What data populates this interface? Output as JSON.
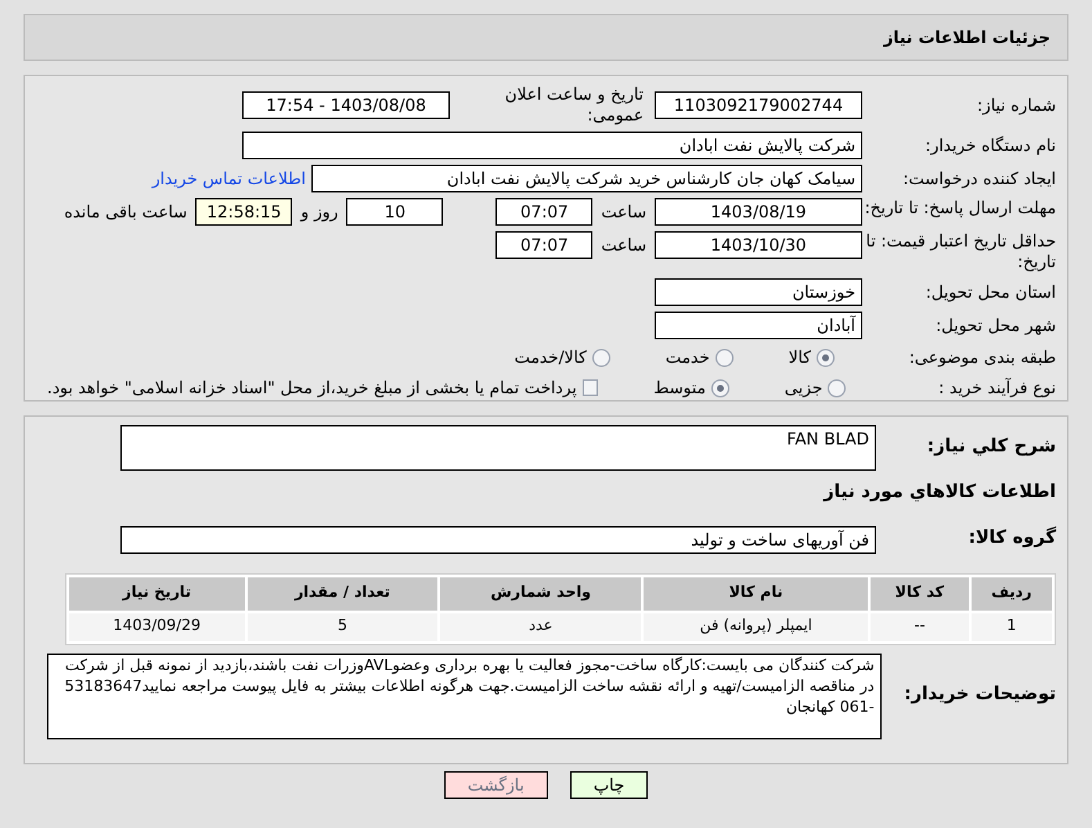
{
  "header": {
    "title": "جزئیات اطلاعات نیاز"
  },
  "need_number": {
    "label": "شماره نیاز:",
    "value": "1103092179002744"
  },
  "announce": {
    "label": "تاریخ و ساعت اعلان عمومی:",
    "value": "1403/08/08 - 17:54"
  },
  "buyer": {
    "label": "نام دستگاه خریدار:",
    "value": "شرکت پالایش نفت ابادان"
  },
  "creator": {
    "label": "ایجاد کننده درخواست:",
    "value": "سیامک کهان جان کارشناس خرید شرکت پالایش نفت ابادان",
    "link": "اطلاعات تماس خریدار"
  },
  "reply_deadline": {
    "label": "مهلت ارسال پاسخ: تا تاریخ:",
    "date": "1403/08/19",
    "time_label": "ساعت",
    "time": "07:07",
    "days": "10",
    "days_label": "روز و",
    "remaining": "12:58:15",
    "remaining_label": "ساعت باقی مانده"
  },
  "price_validity": {
    "label": "حداقل تاریخ اعتبار قیمت: تا تاریخ:",
    "date": "1403/10/30",
    "time_label": "ساعت",
    "time": "07:07"
  },
  "province": {
    "label": "استان محل تحویل:",
    "value": "خوزستان"
  },
  "city": {
    "label": "شهر محل تحویل:",
    "value": "آبادان"
  },
  "category": {
    "label": "طبقه بندی موضوعی:",
    "options": [
      {
        "label": "کالا",
        "selected": true
      },
      {
        "label": "خدمت",
        "selected": false
      },
      {
        "label": "کالا/خدمت",
        "selected": false
      }
    ]
  },
  "process": {
    "label": "نوع فرآیند خرید :",
    "options": [
      {
        "label": "جزیی",
        "selected": false
      },
      {
        "label": "متوسط",
        "selected": true
      }
    ],
    "payment": {
      "label": "پرداخت تمام یا بخشی از مبلغ خرید،از محل \"اسناد خزانه اسلامی\" خواهد بود.",
      "checked": false
    }
  },
  "summary": {
    "label": "شرح کلي نیاز:",
    "value": "FAN BLAD"
  },
  "goods_title": "اطلاعات کالاهاي مورد نیاز",
  "goods_group": {
    "label": "گروه کالا:",
    "value": "فن آوریهای ساخت و تولید"
  },
  "table": {
    "columns": [
      "ردیف",
      "کد کالا",
      "نام کالا",
      "واحد شمارش",
      "تعداد / مقدار",
      "تاریخ نیاز"
    ],
    "rows": [
      [
        "1",
        "--",
        "ایمپلر (پروانه) فن",
        "عدد",
        "5",
        "1403/09/29"
      ]
    ]
  },
  "buyer_notes": {
    "label": "توضیحات خریدار:",
    "value": "شرکت کنندگان می بایست:کارگاه ساخت-مجوز فعالیت یا بهره برداری وعضوAVLوزرات نفت باشند،بازدید از نمونه قبل از شرکت در مناقصه الزامیست/تهیه و ارائه نقشه ساخت الزامیست.جهت هرگونه اطلاعات بیشتر به فایل پیوست مراجعه نمایید53183647 -061 کهانجان"
  },
  "buttons": [
    {
      "label": "چاپ",
      "kind": "print"
    },
    {
      "label": "بازگشت",
      "kind": "back"
    }
  ]
}
